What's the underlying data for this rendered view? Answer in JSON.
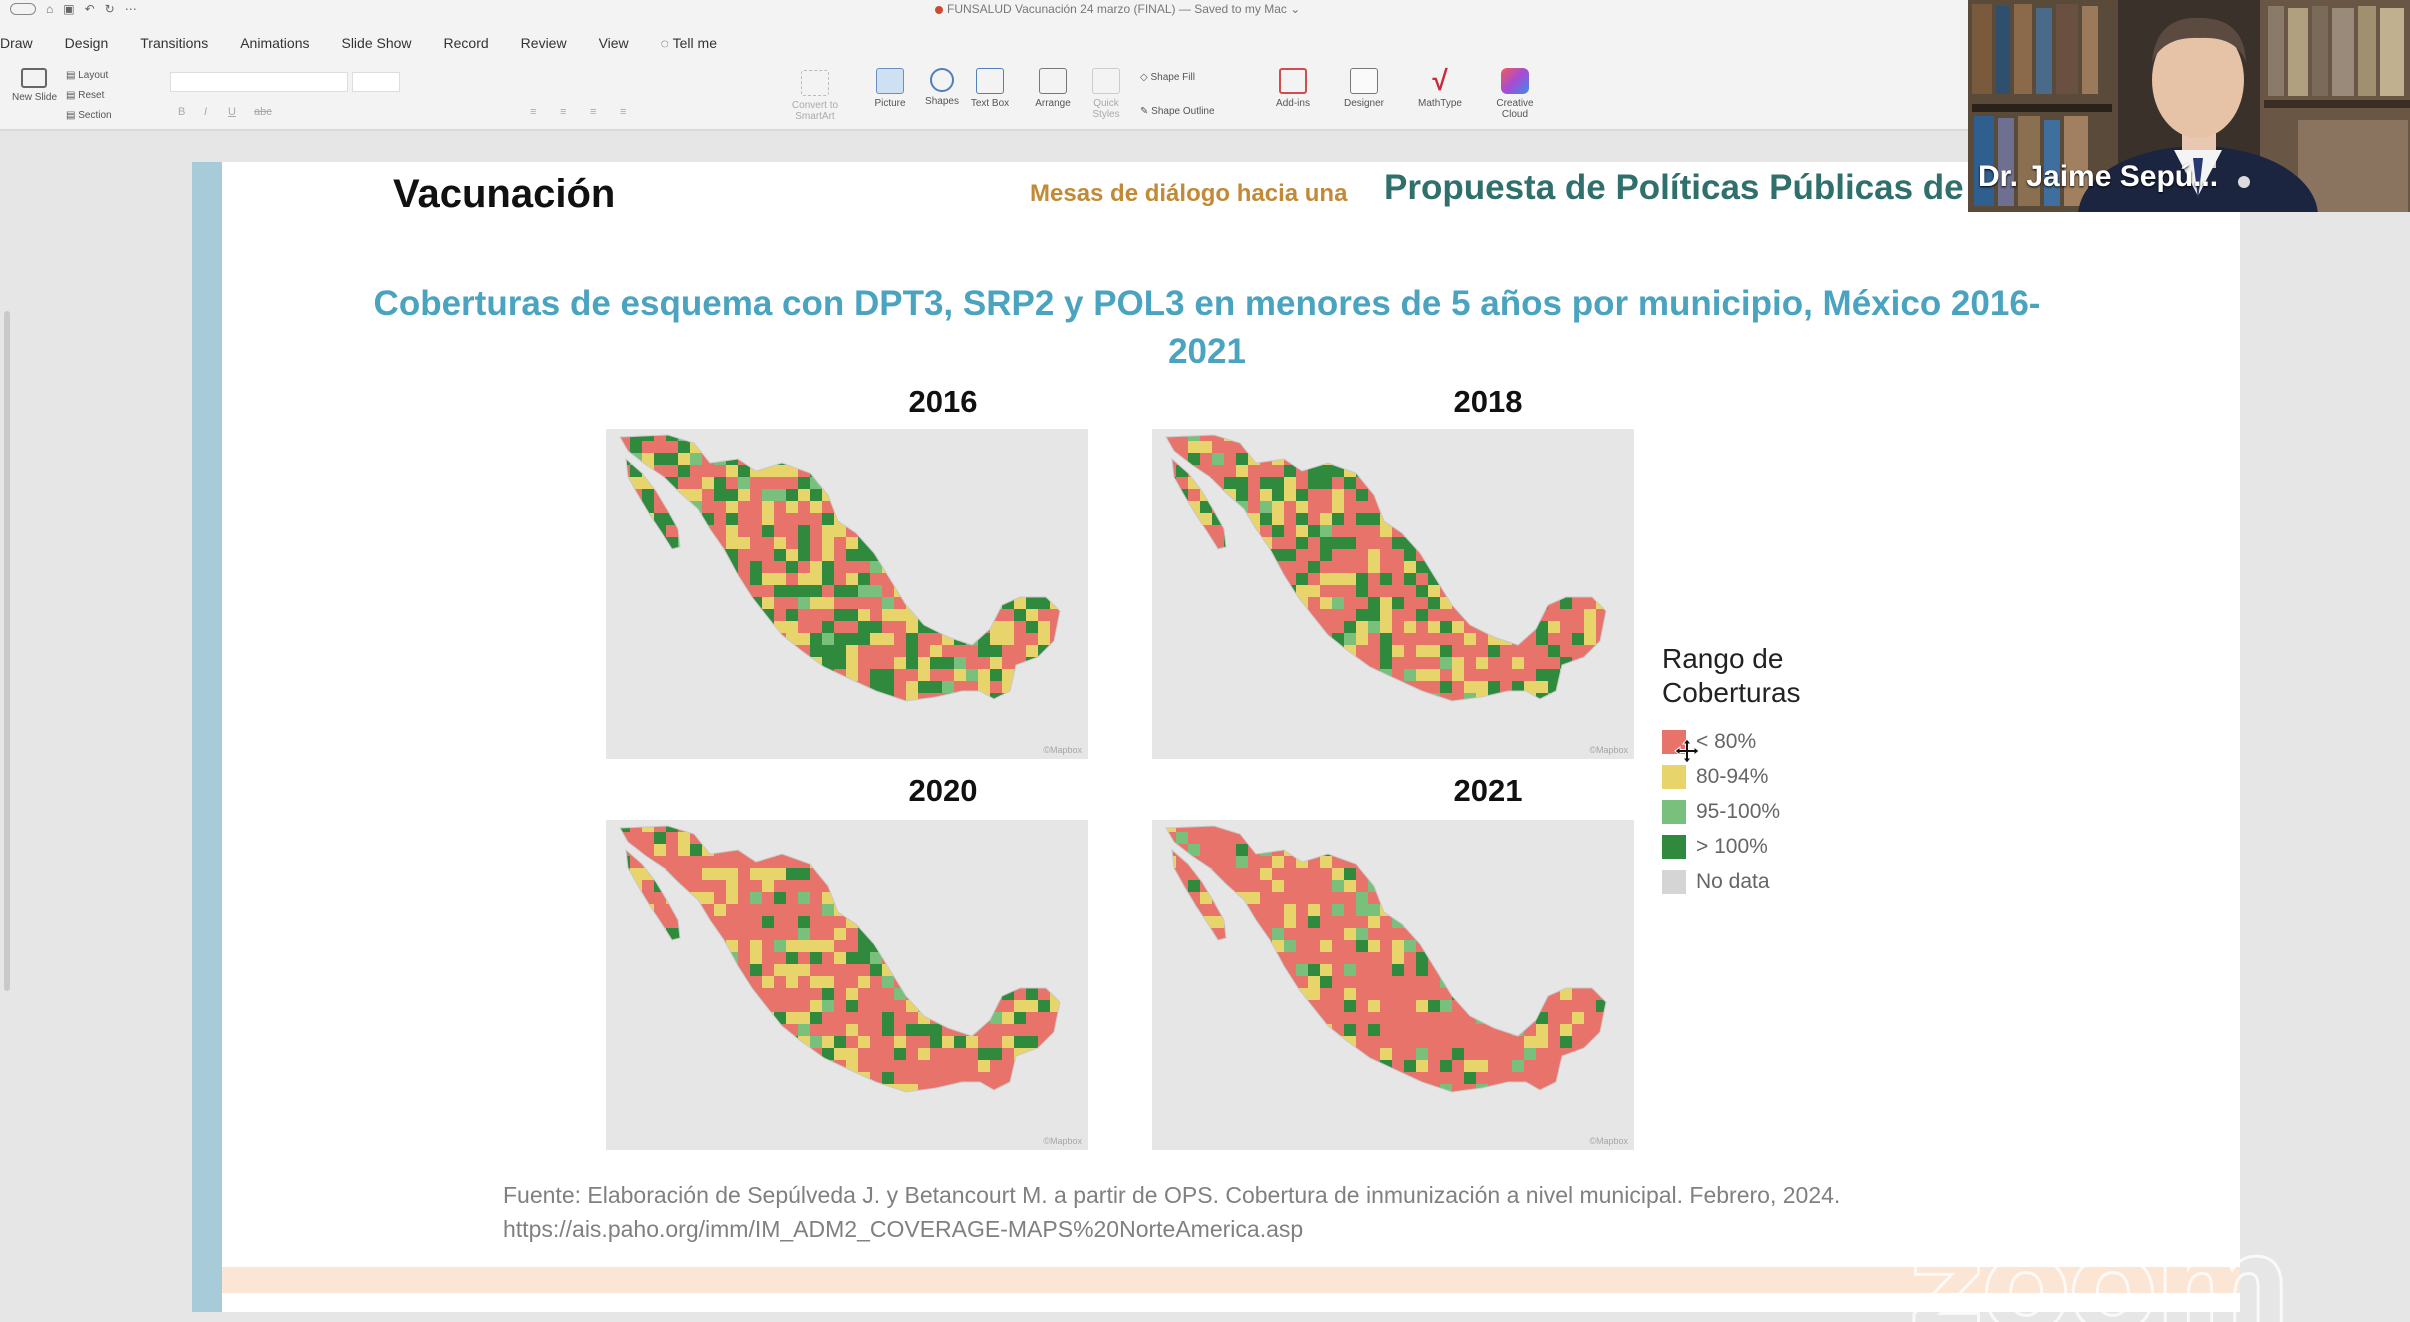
{
  "titlebar": {
    "document_title": "FUNSALUD Vacunación 24 marzo (FINAL) — Saved to my Mac"
  },
  "menu": {
    "items": [
      "Draw",
      "Design",
      "Transitions",
      "Animations",
      "Slide Show",
      "Record",
      "Review",
      "View"
    ],
    "tell_me": "Tell me"
  },
  "ribbon": {
    "new_slide": "New Slide",
    "layout": "Layout",
    "reset": "Reset",
    "section": "Section",
    "convert_smartart": "Convert to SmartArt",
    "picture": "Picture",
    "shapes": "Shapes",
    "text_box": "Text Box",
    "arrange": "Arrange",
    "quick_styles": "Quick Styles",
    "shape_fill": "Shape Fill",
    "shape_outline": "Shape Outline",
    "add_ins": "Add-ins",
    "designer": "Designer",
    "mathtype": "MathType",
    "creative_cloud": "Creative Cloud"
  },
  "slide": {
    "heading": "Vacunación",
    "tagline": "Mesas de diálogo hacia una",
    "proposal": "Propuesta de Políticas Públicas de S",
    "chart_title": "Coberturas de esquema con DPT3, SRP2 y POL3 en menores de 5 años por municipio, México 2016-2021",
    "maps": [
      {
        "year": "2016"
      },
      {
        "year": "2018"
      },
      {
        "year": "2020"
      },
      {
        "year": "2021"
      }
    ],
    "map_credit": "©Mapbox",
    "legend": {
      "title_line1": "Rango de",
      "title_line2": "Coberturas",
      "items": [
        {
          "label": "< 80%",
          "color": "#e8736a"
        },
        {
          "label": "80-94%",
          "color": "#e7d46a"
        },
        {
          "label": "95-100%",
          "color": "#78c07c"
        },
        {
          "label": "> 100%",
          "color": "#2f8a3e"
        },
        {
          "label": "No data",
          "color": "#d5d5d5"
        }
      ]
    },
    "source_line1": "Fuente: Elaboración de Sepúlveda J. y Betancourt M. a partir de OPS. Cobertura de inmunización a nivel municipal. Febrero, 2024.",
    "source_line2": "https://ais.paho.org/imm/IM_ADM2_COVERAGE-MAPS%20NorteAmerica.asp"
  },
  "zoom": {
    "participant_name": "Dr. Jaime Sepú...",
    "watermark": "zoom"
  }
}
